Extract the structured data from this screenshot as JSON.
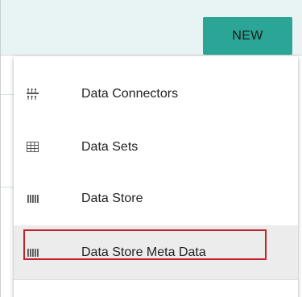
{
  "header": {
    "new_button_label": "NEW",
    "accent_color": "#2aa596"
  },
  "menu": {
    "items": [
      {
        "label": "Data Connectors",
        "icon": "data-connectors-icon"
      },
      {
        "label": "Data Sets",
        "icon": "grid-table-icon"
      },
      {
        "label": "Data Store",
        "icon": "barcode-icon"
      },
      {
        "label": "Data Store Meta Data",
        "icon": "barcode-icon",
        "state": "hovered",
        "highlight_color": "#c8202a"
      }
    ]
  }
}
